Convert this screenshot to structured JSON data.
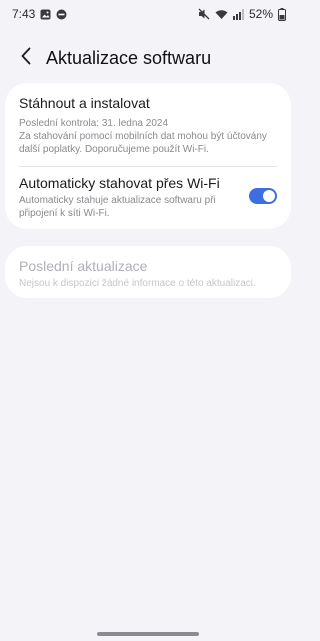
{
  "status_bar": {
    "time": "7:43",
    "battery": "52%",
    "left_icons": [
      "gallery-notification-icon",
      "dnd-notification-icon"
    ],
    "right_icons": [
      "mute-icon",
      "wifi-icon",
      "signal-icon",
      "battery-icon"
    ]
  },
  "header": {
    "title": "Aktualizace softwaru",
    "back_icon": "chevron-left-icon"
  },
  "download_card": {
    "download": {
      "title": "Stáhnout a instalovat",
      "last_check": "Poslední kontrola: 31. ledna 2024",
      "note": "Za stahování pomocí mobilních dat mohou být účtovány další poplatky. Doporučujeme použít Wi-Fi."
    },
    "auto_wifi": {
      "title": "Automaticky stahovat přes Wi-Fi",
      "subtitle": "Automaticky stahuje aktualizace softwaru při připojení k síti Wi-Fi.",
      "enabled": true
    }
  },
  "last_update_card": {
    "title": "Poslední aktualizace",
    "subtitle": "Nejsou k dispozici žádné informace o této aktualizaci.",
    "disabled": true
  },
  "colors": {
    "background": "#f4f3f8",
    "card": "#ffffff",
    "accent": "#3e6fe1",
    "secondary_text": "#8a8a8f",
    "disabled_text": "#b1b0b6"
  }
}
